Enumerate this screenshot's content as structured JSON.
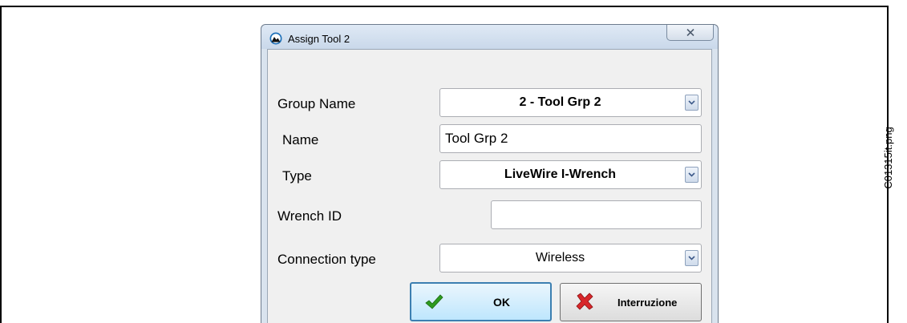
{
  "caption": "C01315it.png",
  "window": {
    "title": "Assign Tool  2",
    "close_glyph": "✕"
  },
  "form": {
    "group_name": {
      "label": "Group Name",
      "value": "2 - Tool Grp 2"
    },
    "name": {
      "label": "Name",
      "value": "Tool Grp 2"
    },
    "type": {
      "label": "Type",
      "value": "LiveWire I-Wrench"
    },
    "wrench_id": {
      "label": "Wrench ID",
      "value": ""
    },
    "connection_type": {
      "label": "Connection type",
      "value": "Wireless"
    }
  },
  "buttons": {
    "ok": {
      "label": "OK",
      "icon": "green-checkmark-icon",
      "color": "#2e9b1f"
    },
    "cancel": {
      "label": "Interruzione",
      "icon": "red-x-icon",
      "color": "#d8262a"
    }
  },
  "colors": {
    "dialog_frame": "#d9e3ee",
    "client_bg": "#f0f0f0",
    "default_button_border": "#3c7fb1"
  }
}
